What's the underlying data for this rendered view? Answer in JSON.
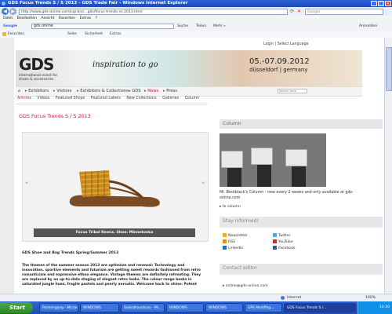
{
  "window": {
    "title": "GDS Focus Trends S / S 2013 - GDS Trade Fair - Windows Internet Explorer",
    "minimize": "_",
    "maximize": "□",
    "close": "✕"
  },
  "addressbar": {
    "url": "http://www.gds-online.com/cgi-bin/...gds/focus-trends-ss-2013.html",
    "search_placeholder": "Google"
  },
  "menubar": {
    "items": [
      "Datei",
      "Bearbeiten",
      "Ansicht",
      "Favoriten",
      "Extras",
      "?"
    ]
  },
  "googlebar": {
    "label": "Google",
    "query": "gds online",
    "search_button": "Suche",
    "share": "Teilen",
    "more": "Mehr »",
    "signin": "Anmelden"
  },
  "favbar": {
    "favorites": "Favoriten",
    "right_items": [
      "Seite",
      "Sicherheit",
      "Extras"
    ]
  },
  "site": {
    "toplinks": "Login  |  Select Language",
    "logo": "GDS",
    "logo_sub": "international event for shoes & accessories",
    "inspiration": "inspiration to go",
    "date": "05.-07.09.2012",
    "city": "düsseldorf | germany",
    "nav": [
      "Exhibitors",
      "Visitors",
      "Exhibitors & Collections",
      "GDS",
      "News",
      "Press"
    ],
    "search_placeholder": "Search term",
    "subnav": [
      "Articles",
      "Videos",
      "Featured Shops",
      "Featured Labels",
      "New Collections",
      "Galleries",
      "Column"
    ],
    "page_title": "GDS Focus Trends S / S 2013",
    "slider_caption": "Focus Tribal Remix, Shoe: Minnetonka",
    "prev": "«",
    "next": "»",
    "article_heading": "GDS Shoe and Bag Trends Spring/Summer 2013",
    "article_body": "The themes of the summer season 2013 are optimism and renewal: Technology and innovation, sportive elements and futurism are getting sweet rewards fashioned from retro romanticism and expressive ethno elegance. Vintage themes are definitely retreating. They are replaced by an up-to-date staging of elegant retro looks. The colour range basks in saturated jungle hues, fragile pastels and pearly aeroatis. Welcome back to shine: Potent"
  },
  "sidebar": {
    "column_title": "Column",
    "column_text": "Mr. Bootblack's Column - new every 2 weeks and only available at gds-online.com",
    "to_column": "to column",
    "stay_title": "Stay informed!",
    "social": [
      "Newsletter",
      "Twitter",
      "RSS",
      "YouTube",
      "LinkedIn",
      "Facebook"
    ],
    "contact_title": "Contact editor",
    "email": "online@gds-online.com"
  },
  "statusbar": {
    "zone": "Internet",
    "zoom": "100%"
  },
  "taskbar": {
    "start": "Start",
    "tasks": [
      "Posteingang - Micros...",
      "WINDOWS",
      "Globalhausbrau - Mi...",
      "WINDOWS",
      "WINDOWS",
      "GPS Modifihg...",
      "GDS Focus Trends S /..."
    ],
    "clock": "14:30"
  }
}
